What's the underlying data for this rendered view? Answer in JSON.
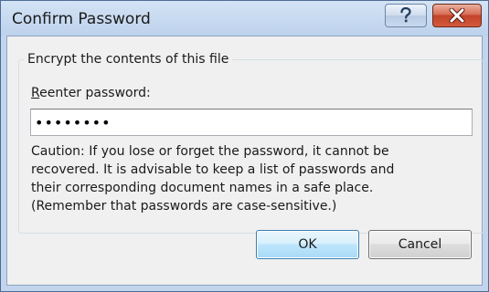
{
  "window": {
    "title": "Confirm Password",
    "help_label": "?",
    "close_icon": "close-icon",
    "help_icon": "help-icon"
  },
  "group": {
    "caption": "Encrypt the contents of this file"
  },
  "field": {
    "label_mnemonic": "R",
    "label_rest": "eenter password:",
    "value": "••••••••"
  },
  "caution": {
    "lines": [
      "Caution: If you lose or forget the password, it cannot be",
      "recovered. It is advisable to keep a list of passwords and",
      "their corresponding document names in a safe place.",
      "(Remember that passwords are case-sensitive.)"
    ]
  },
  "buttons": {
    "ok_label": "OK",
    "cancel_label": "Cancel"
  },
  "colors": {
    "title_bar": "#c2d5ec",
    "close_button": "#c1432a",
    "ok_border": "#3c7fb1",
    "dialog_face": "#f0f0f0"
  }
}
